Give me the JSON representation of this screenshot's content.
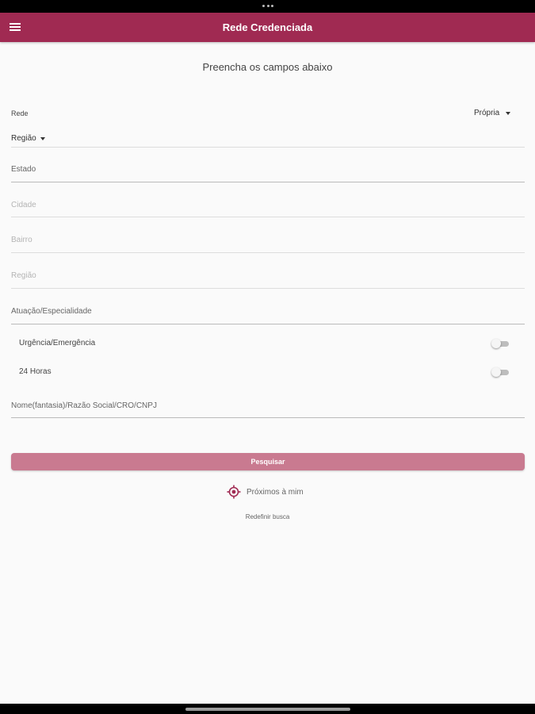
{
  "app": {
    "title": "Rede Credenciada",
    "accent_color": "#a02a52",
    "button_color": "#c97a90"
  },
  "form": {
    "subtitle": "Preencha os campos abaixo",
    "rede": {
      "label": "Rede",
      "value": "Própria"
    },
    "regiao_dropdown": {
      "value": "Região"
    },
    "fields": [
      {
        "placeholder": "Estado",
        "enabled": true
      },
      {
        "placeholder": "Cidade",
        "enabled": false
      },
      {
        "placeholder": "Bairro",
        "enabled": false
      },
      {
        "placeholder": "Região",
        "enabled": false
      },
      {
        "placeholder": "Atuação/Especialidade",
        "enabled": true
      }
    ],
    "switches": [
      {
        "label": "Urgência/Emergência",
        "on": false
      },
      {
        "label": "24 Horas",
        "on": false
      }
    ],
    "name_field": {
      "placeholder": "Nome(fantasia)/Razão Social/CRO/CNPJ"
    }
  },
  "actions": {
    "search_label": "Pesquisar",
    "near_me_label": "Próximos à mim",
    "near_me_icon": "location-target-icon",
    "reset_label": "Redefinir busca"
  }
}
